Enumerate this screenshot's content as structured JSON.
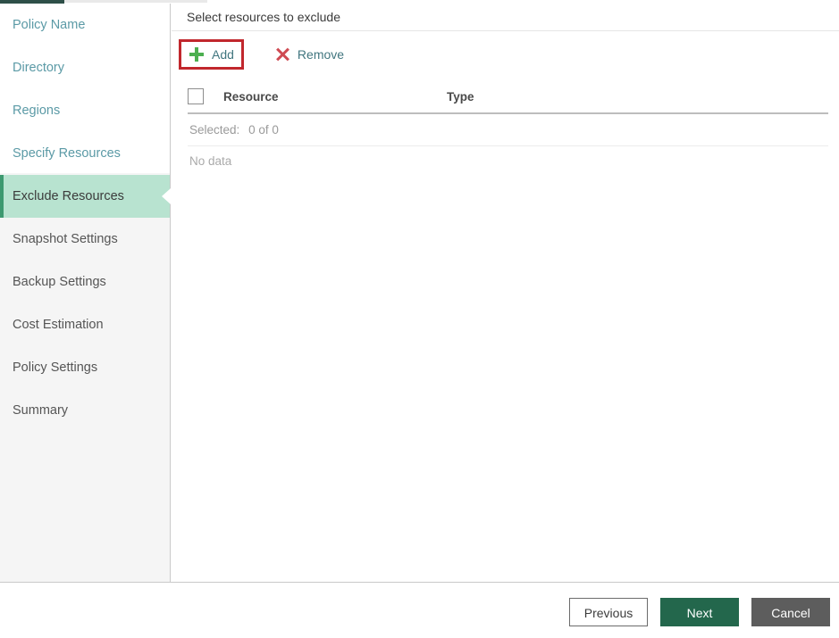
{
  "theme": {
    "accent_dark_green": "#2e4f48",
    "active_nav_bg": "#b8e3d0",
    "active_nav_border": "#3d9970",
    "link_teal": "#5b9aa6",
    "highlight_red": "#c1272d",
    "plus_green": "#4caf50",
    "remove_red": "#cf4b53",
    "next_green": "#23674c",
    "cancel_gray": "#5d5d5d"
  },
  "sidebar": {
    "items": [
      {
        "label": "Policy Name",
        "state": "above"
      },
      {
        "label": "Directory",
        "state": "above"
      },
      {
        "label": "Regions",
        "state": "above"
      },
      {
        "label": "Specify Resources",
        "state": "above"
      },
      {
        "label": "Exclude Resources",
        "state": "active"
      },
      {
        "label": "Snapshot Settings",
        "state": "below"
      },
      {
        "label": "Backup Settings",
        "state": "below"
      },
      {
        "label": "Cost Estimation",
        "state": "below"
      },
      {
        "label": "Policy Settings",
        "state": "below"
      },
      {
        "label": "Summary",
        "state": "below"
      }
    ]
  },
  "content": {
    "header_title": "Select resources to exclude",
    "toolbar": {
      "add_label": "Add",
      "add_icon": "plus-icon",
      "add_highlighted": true,
      "remove_label": "Remove",
      "remove_icon": "x-icon"
    },
    "grid": {
      "select_all_checked": false,
      "columns": [
        {
          "key": "resource",
          "label": "Resource"
        },
        {
          "key": "type",
          "label": "Type"
        }
      ],
      "selected_label": "Selected:",
      "selected_count": "0 of 0",
      "empty_message": "No data",
      "rows": []
    }
  },
  "footer": {
    "previous_label": "Previous",
    "next_label": "Next",
    "cancel_label": "Cancel"
  }
}
